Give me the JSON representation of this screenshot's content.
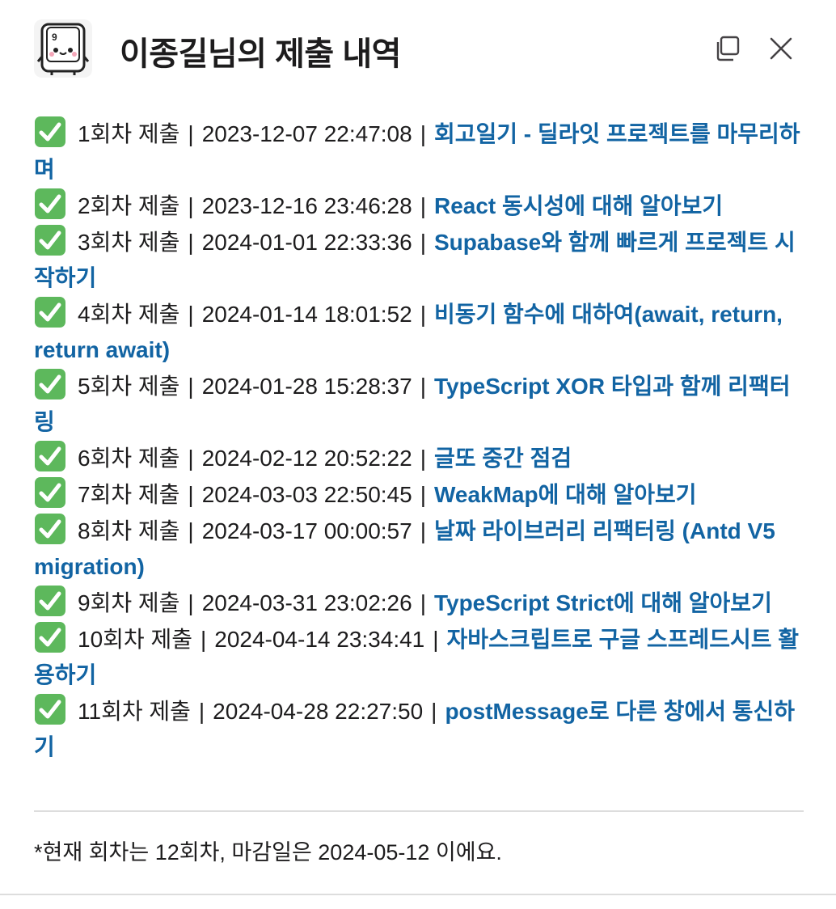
{
  "header": {
    "title": "이종길님의 제출 내역",
    "app_icon": "keycap-mascot-icon",
    "app_icon_keycap_label": "9",
    "copy_icon": "copy-icon",
    "close_icon": "close-icon"
  },
  "submissions": [
    {
      "round": "1회차 제출",
      "time": "2023-12-07 22:47:08",
      "title": "회고일기 - 딜라잇 프로젝트를 마무리하며"
    },
    {
      "round": "2회차 제출",
      "time": "2023-12-16 23:46:28",
      "title": "React 동시성에 대해 알아보기"
    },
    {
      "round": "3회차 제출",
      "time": "2024-01-01 22:33:36",
      "title": "Supabase와 함께 빠르게 프로젝트 시작하기"
    },
    {
      "round": "4회차 제출",
      "time": "2024-01-14 18:01:52",
      "title": "비동기 함수에 대하여(await, return, return await)"
    },
    {
      "round": "5회차 제출",
      "time": "2024-01-28 15:28:37",
      "title": "TypeScript XOR 타입과 함께 리팩터링"
    },
    {
      "round": "6회차 제출",
      "time": "2024-02-12 20:52:22",
      "title": "글또 중간 점검"
    },
    {
      "round": "7회차 제출",
      "time": "2024-03-03 22:50:45",
      "title": "WeakMap에 대해 알아보기"
    },
    {
      "round": "8회차 제출",
      "time": "2024-03-17 00:00:57",
      "title": "날짜 라이브러리 리팩터링 (Antd V5 migration)"
    },
    {
      "round": "9회차 제출",
      "time": "2024-03-31 23:02:26",
      "title": "TypeScript Strict에 대해 알아보기"
    },
    {
      "round": "10회차 제출",
      "time": "2024-04-14 23:34:41",
      "title": "자바스크립트로 구글 스프레드시트 활용하기"
    },
    {
      "round": "11회차 제출",
      "time": "2024-04-28 22:27:50",
      "title": "postMessage로 다른 창에서 통신하기"
    }
  ],
  "separator": "|",
  "status_icon": "check-mark-icon",
  "colors": {
    "link": "#1264a3",
    "check_bg": "#5db85c",
    "text": "#1d1c1d"
  },
  "footnote": "*현재 회차는 12회차, 마감일은 2024-05-12 이에요."
}
